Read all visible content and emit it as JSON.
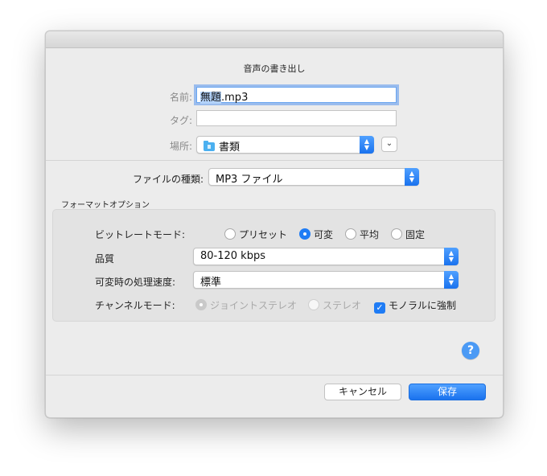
{
  "dialog": {
    "title": "音声の書き出し",
    "name_label": "名前:",
    "name_value_selected": "無題",
    "name_value_rest": ".mp3",
    "tags_label": "タグ:",
    "tags_value": "",
    "location_label": "場所:",
    "location_value": "書類",
    "file_type_label": "ファイルの種類:",
    "file_type_value": "MP3 ファイル",
    "format_options_title": "フォーマットオプション",
    "bitrate_mode_label": "ビットレートモード:",
    "bitrate_modes": [
      {
        "label": "プリセット",
        "checked": false
      },
      {
        "label": "可変",
        "checked": true
      },
      {
        "label": "平均",
        "checked": false
      },
      {
        "label": "固定",
        "checked": false
      }
    ],
    "quality_label": "品質",
    "quality_value": "80-120 kbps",
    "vbr_speed_label": "可変時の処理速度:",
    "vbr_speed_value": "標準",
    "channel_mode_label": "チャンネルモード:",
    "channel_modes": [
      {
        "label": "ジョイントステレオ",
        "checked": true,
        "disabled": true
      },
      {
        "label": "ステレオ",
        "checked": false,
        "disabled": true
      }
    ],
    "force_mono_label": "モノラルに強制",
    "force_mono_checked": true,
    "help_label": "?",
    "cancel_label": "キャンセル",
    "save_label": "保存"
  }
}
